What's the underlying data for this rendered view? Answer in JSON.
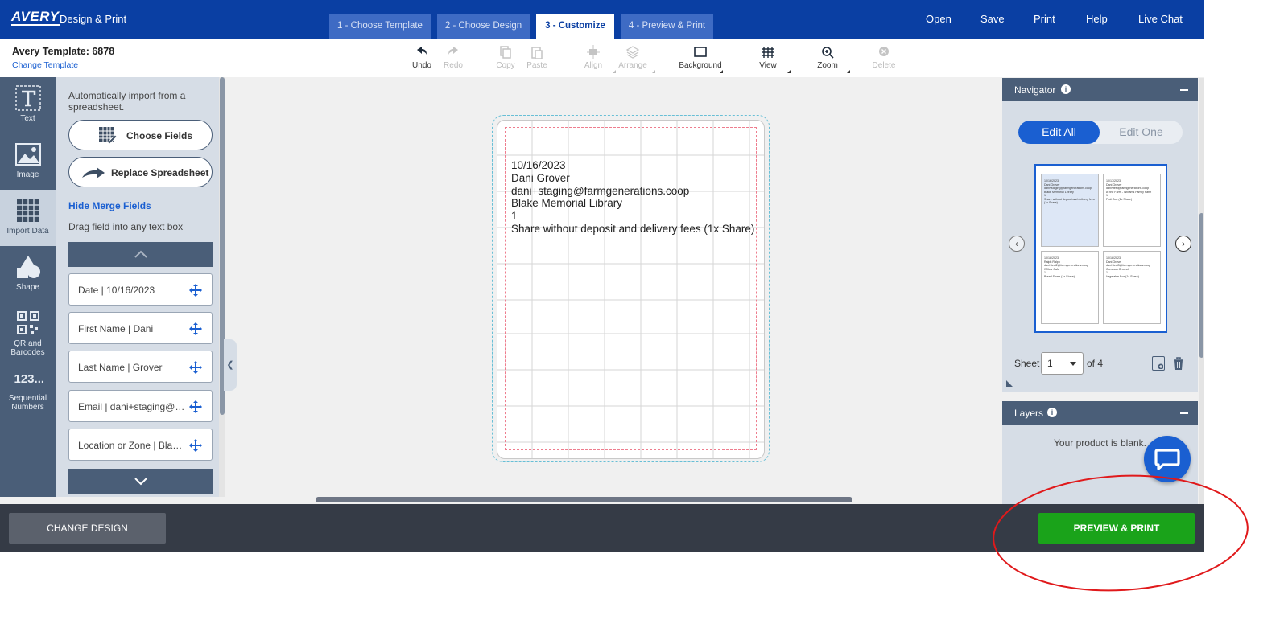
{
  "header": {
    "logo": "AVERY",
    "app_name": "Design & Print",
    "steps": [
      "1 - Choose Template",
      "2 - Choose Design",
      "3 - Customize",
      "4 - Preview & Print"
    ],
    "active_step": 2,
    "links": [
      "Open",
      "Save",
      "Print",
      "Help",
      "Live Chat"
    ]
  },
  "toolbar": {
    "template_name": "Avery Template: 6878",
    "change_template": "Change Template",
    "tools": [
      {
        "label": "Undo",
        "icon": "undo-icon",
        "enabled": true
      },
      {
        "label": "Redo",
        "icon": "redo-icon",
        "enabled": false
      },
      {
        "label": "Copy",
        "icon": "copy-icon",
        "enabled": false
      },
      {
        "label": "Paste",
        "icon": "paste-icon",
        "enabled": false
      },
      {
        "label": "Align",
        "icon": "align-icon",
        "enabled": false
      },
      {
        "label": "Arrange",
        "icon": "arrange-icon",
        "enabled": false
      },
      {
        "label": "Background",
        "icon": "background-icon",
        "enabled": true
      },
      {
        "label": "View",
        "icon": "grid-icon",
        "enabled": true
      },
      {
        "label": "Zoom",
        "icon": "zoom-icon",
        "enabled": true
      },
      {
        "label": "Delete",
        "icon": "delete-icon",
        "enabled": false
      }
    ]
  },
  "rail": {
    "items": [
      {
        "label": "Text",
        "icon": "text-icon"
      },
      {
        "label": "Image",
        "icon": "image-icon"
      },
      {
        "label": "Import Data",
        "icon": "table-icon"
      },
      {
        "label": "Shape",
        "icon": "shape-icon"
      },
      {
        "label": "QR and Barcodes",
        "icon": "qr-code-icon"
      },
      {
        "label": "Sequential Numbers",
        "icon": "numbers-icon",
        "glyph": "123..."
      }
    ],
    "active_index": 2
  },
  "merge_panel": {
    "intro": "Automatically import from a spreadsheet.",
    "choose_fields": "Choose Fields",
    "replace_spreadsheet": "Replace Spreadsheet",
    "hide_merge_fields": "Hide Merge Fields",
    "drag_hint": "Drag field into any text box",
    "fields": [
      "Date | 10/16/2023",
      "First Name | Dani",
      "Last Name | Grover",
      "Email | dani+staging@farmgenerations.coop",
      "Location or Zone | Blake Memorial Library"
    ]
  },
  "label": {
    "lines": [
      "10/16/2023",
      "Dani Grover",
      "dani+staging@farmgenerations.coop",
      "Blake Memorial Library",
      "1",
      "Share without deposit and delivery fees (1x Share)"
    ]
  },
  "navigator": {
    "title": "Navigator",
    "edit_all": "Edit All",
    "edit_one": "Edit One",
    "sheet_label": "Sheet",
    "sheet_value": "1",
    "sheet_of": "of 4",
    "thumbs": [
      {
        "lines": [
          "10/16/2023",
          "Dani Grover",
          "dani+staging@farmgenerations.coop",
          "Blake Memorial Library",
          "1",
          "Share without deposit and delivery fees (1x Share)"
        ]
      },
      {
        "lines": [
          "10/17/2023",
          "Dani Grover",
          "dani+test@farmgenerations.coop",
          "At the Farm - Williams Family Farm",
          "1",
          "Fruit Box (1x Share)"
        ]
      },
      {
        "lines": [
          "10/18/2023",
          "Ralph Ralph",
          "dani+test2@farmgenerations.coop",
          "Willow Cafe",
          "1",
          "Bread Share (1x Share)"
        ]
      },
      {
        "lines": [
          "10/18/2023",
          "Dani Grove",
          "dani+test3@farmgenerations.coop",
          "Common Ground",
          "1",
          "Vegetable Box (1x Share)"
        ]
      }
    ]
  },
  "layers": {
    "title": "Layers",
    "empty": "Your product is blank."
  },
  "bottom": {
    "change_design": "CHANGE DESIGN",
    "preview_print": "PREVIEW & PRINT"
  },
  "colors": {
    "brand_blue": "#0a3fa3",
    "accent_blue": "#1a5fd1",
    "rail": "#4a5e78",
    "primary_green": "#1aa31a",
    "annotation_red": "#e0191b"
  }
}
